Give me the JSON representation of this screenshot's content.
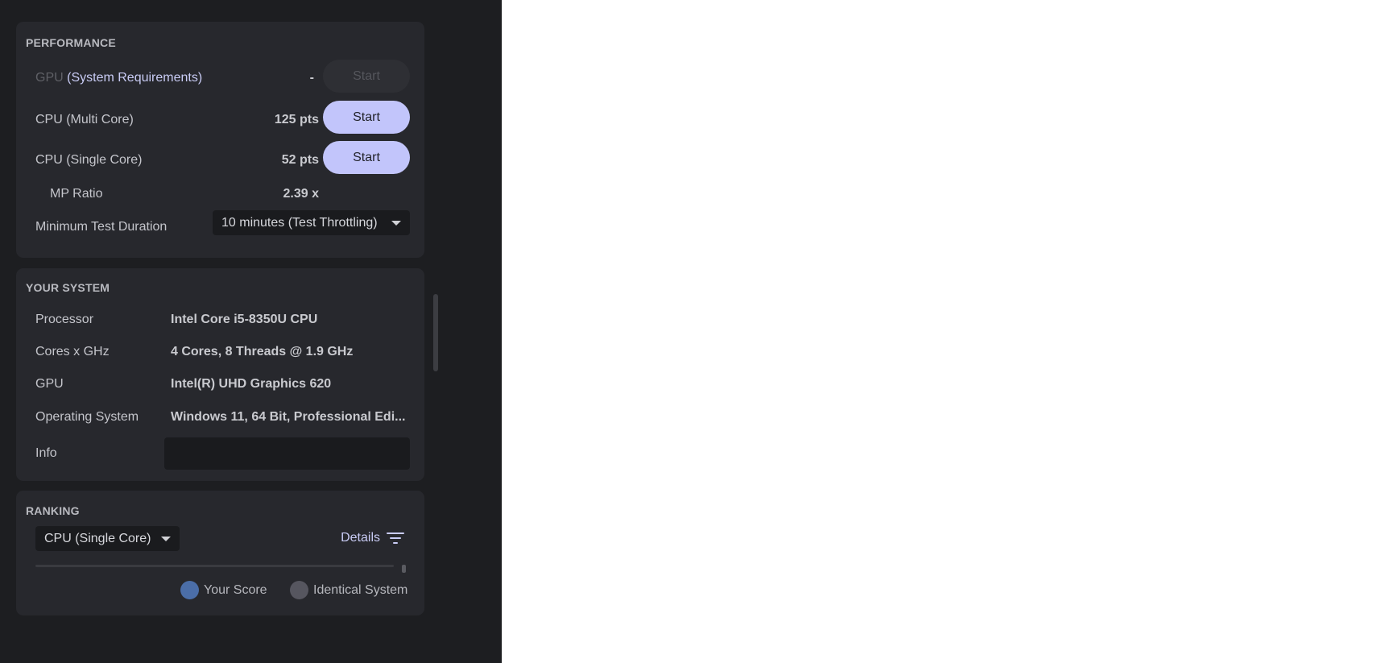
{
  "performance": {
    "title": "PERFORMANCE",
    "gpu": {
      "label_dim": "GPU",
      "label_accent": "(System Requirements)",
      "value": "-",
      "button": "Start"
    },
    "cpu_multi": {
      "label": "CPU (Multi Core)",
      "value": "125 pts",
      "button": "Start"
    },
    "cpu_single": {
      "label": "CPU (Single Core)",
      "value": "52 pts",
      "button": "Start"
    },
    "mp_ratio": {
      "label": "MP Ratio",
      "value": "2.39 x"
    },
    "duration": {
      "label": "Minimum Test Duration",
      "selected": "10 minutes (Test Throttling)"
    }
  },
  "system": {
    "title": "YOUR SYSTEM",
    "rows": [
      {
        "label": "Processor",
        "value": "Intel Core i5-8350U CPU"
      },
      {
        "label": "Cores x GHz",
        "value": "4 Cores, 8 Threads @ 1.9 GHz"
      },
      {
        "label": "GPU",
        "value": "Intel(R) UHD Graphics 620"
      },
      {
        "label": "Operating System",
        "value": "Windows 11, 64 Bit, Professional Edi..."
      },
      {
        "label": "Info",
        "value": ""
      }
    ]
  },
  "ranking": {
    "title": "RANKING",
    "selected": "CPU (Single Core)",
    "details": "Details",
    "legend": [
      {
        "label": "Your Score",
        "color": "#4b6ea8"
      },
      {
        "label": "Identical System",
        "color": "#56565f"
      }
    ]
  }
}
